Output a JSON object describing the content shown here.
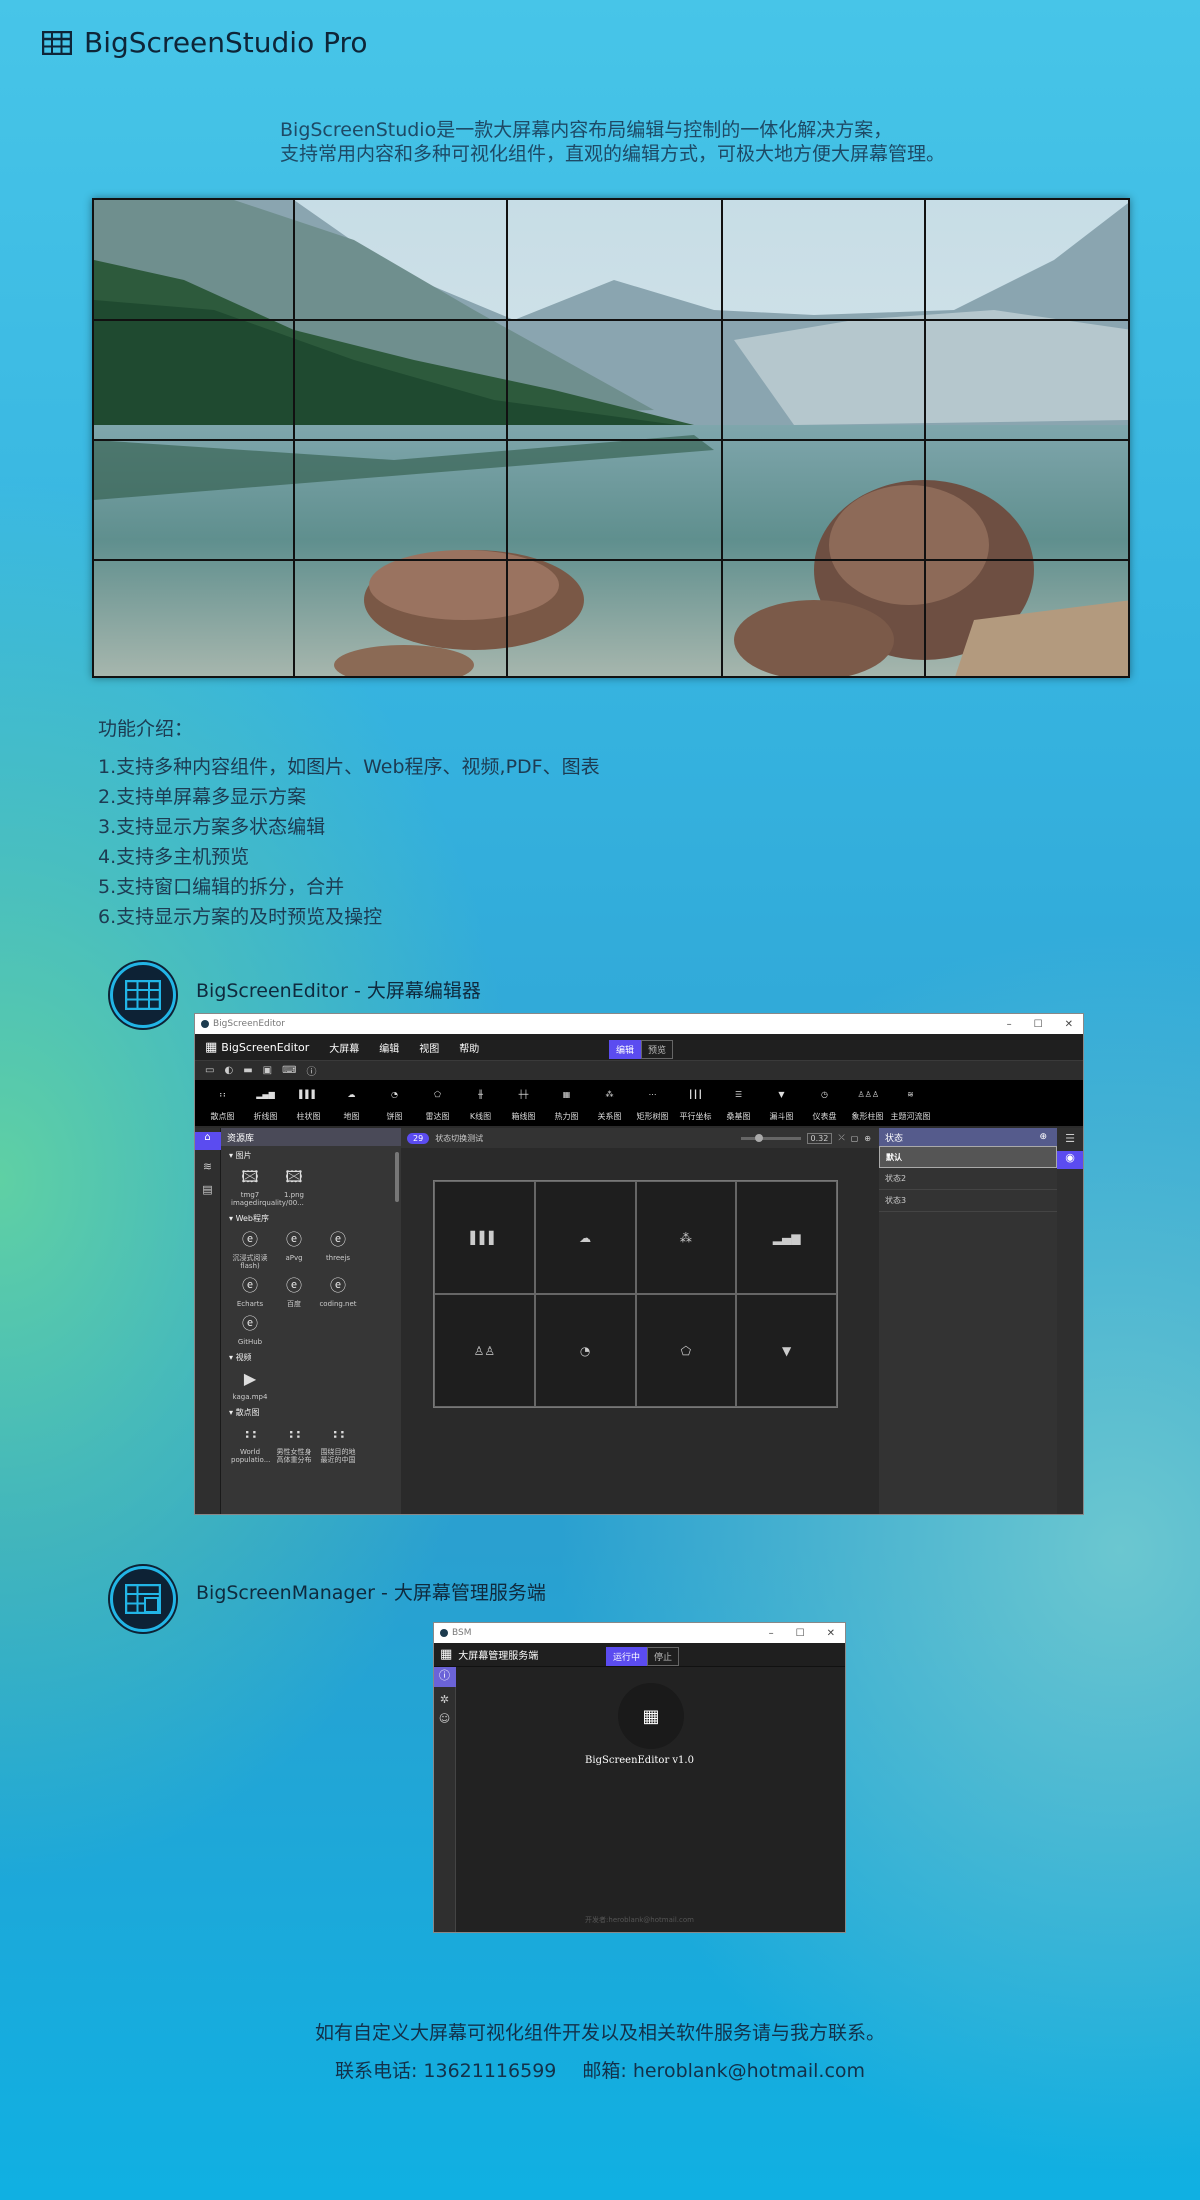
{
  "app": {
    "title": "BigScreenStudio Pro"
  },
  "intro": {
    "line1": "BigScreenStudio是一款大屏幕内容布局编辑与控制的一体化解决方案，",
    "line2": "支持常用内容和多种可视化组件，直观的编辑方式，可极大地方便大屏幕管理。"
  },
  "features": {
    "title": "功能介绍：",
    "items": [
      "1.支持多种内容组件，如图片、Web程序、视频,PDF、图表",
      "2.支持单屏幕多显示方案",
      "3.支持显示方案多状态编辑",
      "4.支持多主机预览",
      "5.支持窗口编辑的拆分，合并",
      "6.支持显示方案的及时预览及操控"
    ]
  },
  "editor": {
    "name": "BigScreenEditor",
    "desc": " - 大屏幕编辑器",
    "window_title": "BigScreenEditor",
    "app_label": "BigScreenEditor",
    "menus": [
      "大屏幕",
      "编辑",
      "视图",
      "帮助"
    ],
    "mode_edit": "编辑",
    "mode_preview": "预览",
    "components": [
      "散点图",
      "折线图",
      "柱状图",
      "地图",
      "饼图",
      "雷达图",
      "K线图",
      "箱线图",
      "热力图",
      "关系图",
      "矩形树图",
      "平行坐标",
      "桑基图",
      "漏斗图",
      "仪表盘",
      "象形柱图",
      "主题河流图"
    ],
    "resource_title": "资源库",
    "groups": {
      "images": "图片",
      "web": "Web程序",
      "video": "视频",
      "scatter": "散点图"
    },
    "image_items": [
      "tmg7 imagedirquality/00...",
      "1.png"
    ],
    "web_items": [
      "沉浸式阅读 flash)",
      "aPvg",
      "threejs",
      "Echarts",
      "百度",
      "coding.net",
      "GitHub"
    ],
    "video_items": [
      "kaga.mp4"
    ],
    "scatter_items": [
      "World populatio...",
      "男性女性身高体重分布",
      "围绕目的地最近的中国"
    ],
    "state_count": "29",
    "state_label": "状态切换测试",
    "zoom": "0.32",
    "state_panel_title": "状态",
    "states": [
      "默认",
      "状态2",
      "状态3"
    ]
  },
  "manager": {
    "name": "BigScreenManager",
    "desc": " - 大屏幕管理服务端",
    "window_title": "BSM",
    "app_label": "大屏幕管理服务端",
    "run": "运行中",
    "stop": "停止",
    "item_label": "BigScreenEditor v1.0",
    "developer": "开发者:heroblank@hotmail.com"
  },
  "contact": {
    "line1": "如有自定义大屏幕可视化组件开发以及相关软件服务请与我方联系。",
    "phone": "联系电话: 13621116599",
    "email": "邮箱: heroblank@hotmail.com"
  },
  "colors": {
    "accent": "#5b4cf0",
    "background_top": "#47c5e8",
    "icon_ring": "#22b5e6"
  }
}
